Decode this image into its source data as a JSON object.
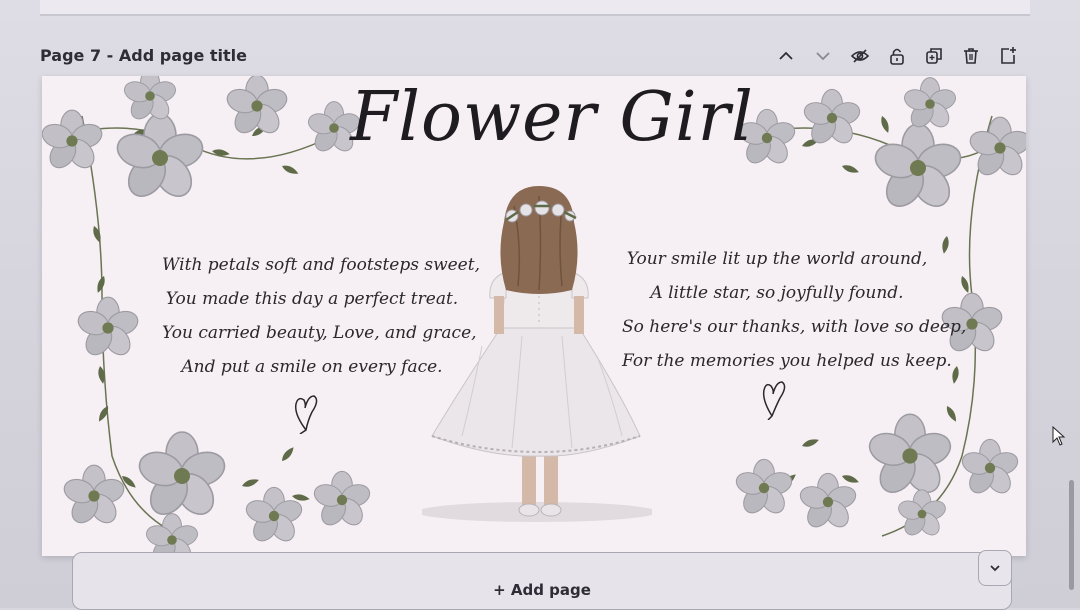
{
  "page_header": {
    "title": "Page 7 - Add page title",
    "actions": [
      "chevron-up-icon",
      "chevron-down-icon",
      "eye-hide-icon",
      "lock-icon",
      "duplicate-icon",
      "trash-icon",
      "add-page-icon"
    ]
  },
  "design": {
    "title": "Flower Girl",
    "poem_left": [
      "With petals soft and footsteps sweet,",
      "You made this day a perfect treat.",
      "You carried beauty, Love, and grace,",
      "And put a smile on every face."
    ],
    "poem_right": [
      "Your smile lit up the world around,",
      "A little star, so joyfully found.",
      "So here's our thanks, with love so deep,",
      "For the memories you helped us keep."
    ],
    "colors": {
      "background": "#f6eff3",
      "leaf": "#5e6a48",
      "flower": "#b9b7bd",
      "text": "#1e1c20"
    }
  },
  "add_page": {
    "label": "+ Add page"
  }
}
